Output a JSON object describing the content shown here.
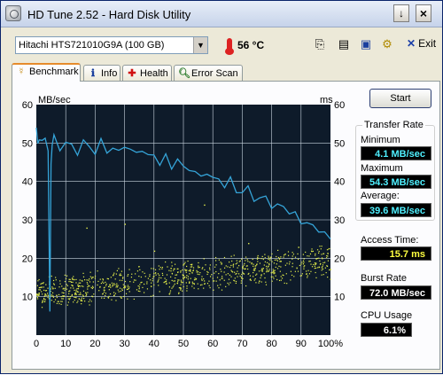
{
  "window": {
    "title": "HD Tune 2.52 - Hard Disk Utility",
    "help_glyph": "↓",
    "close_glyph": "×"
  },
  "toolbar": {
    "drive": "Hitachi HTS721010G9A (100 GB)",
    "temperature": "56 °C",
    "exit_label": "Exit"
  },
  "tabs": [
    {
      "label": "Benchmark",
      "icon": "benchmark-icon"
    },
    {
      "label": "Info",
      "icon": "info-icon"
    },
    {
      "label": "Health",
      "icon": "health-icon"
    },
    {
      "label": "Error Scan",
      "icon": "error-scan-icon"
    }
  ],
  "sidebar": {
    "start_label": "Start",
    "transfer_rate_label": "Transfer Rate",
    "minimum_label": "Minimum",
    "minimum_value": "4.1 MB/sec",
    "maximum_label": "Maximum",
    "maximum_value": "54.3 MB/sec",
    "average_label": "Average:",
    "average_value": "39.6 MB/sec",
    "access_label": "Access Time:",
    "access_value": "15.7 ms",
    "burst_label": "Burst Rate",
    "burst_value": "72.0 MB/sec",
    "cpu_label": "CPU Usage",
    "cpu_value": "6.1%"
  },
  "colors": {
    "plot_bg": "#0e1b2a",
    "grid": "#c9d6e0",
    "transfer_line": "#35a4d8",
    "access_dots": "#e6f04a"
  },
  "chart_data": {
    "type": "line",
    "ylabel_left": "MB/sec",
    "ylabel_right": "ms",
    "x_ticks": [
      "0",
      "10",
      "20",
      "30",
      "40",
      "50",
      "60",
      "70",
      "80",
      "90",
      "100%"
    ],
    "y_ticks": [
      "0",
      "10",
      "20",
      "30",
      "40",
      "50",
      "60"
    ],
    "xlim": [
      0,
      100
    ],
    "ylim": [
      0,
      60
    ],
    "grid": true,
    "series": [
      {
        "kind": "transfer-rate",
        "x": [
          0,
          0.5,
          1,
          2,
          3,
          4,
          4.6,
          5,
          5.4,
          6,
          8,
          10,
          12,
          14,
          16,
          18,
          20,
          22,
          24,
          26,
          28,
          30,
          32,
          34,
          36,
          38,
          40,
          42,
          44,
          46,
          48,
          50,
          52,
          54,
          56,
          58,
          60,
          62,
          64,
          66,
          68,
          70,
          72,
          74,
          76,
          78,
          80,
          82,
          84,
          86,
          88,
          90,
          92,
          94,
          96,
          98,
          100
        ],
        "values": [
          54,
          49,
          52,
          50,
          51,
          49,
          5,
          45,
          50,
          51,
          49,
          50,
          49,
          48,
          50,
          49,
          48,
          50,
          48,
          49,
          47,
          50,
          48,
          47,
          49,
          46,
          47,
          45,
          46,
          44,
          46,
          43,
          44,
          42,
          41,
          43,
          40,
          41,
          39,
          40,
          38,
          37,
          38,
          36,
          35,
          36,
          34,
          33,
          34,
          32,
          31,
          30,
          29,
          28,
          28,
          26,
          25
        ]
      }
    ],
    "access_scatter": {
      "kind": "access-time",
      "x_range": [
        0,
        100
      ],
      "start_band": [
        8,
        14
      ],
      "end_band": [
        16,
        23
      ],
      "outliers": [
        [
          17,
          28
        ],
        [
          57,
          34
        ],
        [
          40,
          22
        ],
        [
          72,
          24
        ],
        [
          89,
          23
        ],
        [
          30,
          29
        ],
        [
          95,
          20
        ]
      ]
    }
  }
}
